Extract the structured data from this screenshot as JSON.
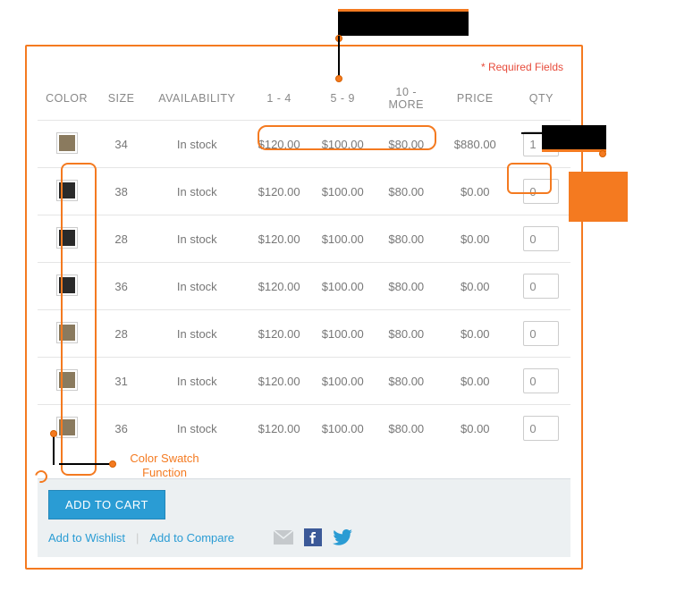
{
  "required_label": "* Required Fields",
  "headers": {
    "color": "COLOR",
    "size": "SIZE",
    "availability": "AVAILABILITY",
    "tier1": "1 - 4",
    "tier2": "5 - 9",
    "tier3": "10 - MORE",
    "price": "PRICE",
    "qty": "QTY"
  },
  "rows": [
    {
      "swatch": "#8a7a5e",
      "size": "34",
      "avail": "In stock",
      "t1": "$120.00",
      "t2": "$100.00",
      "t3": "$80.00",
      "price": "$880.00",
      "qty": "1"
    },
    {
      "swatch": "#2a2a2a",
      "size": "38",
      "avail": "In stock",
      "t1": "$120.00",
      "t2": "$100.00",
      "t3": "$80.00",
      "price": "$0.00",
      "qty": "0"
    },
    {
      "swatch": "#2a2a2a",
      "size": "28",
      "avail": "In stock",
      "t1": "$120.00",
      "t2": "$100.00",
      "t3": "$80.00",
      "price": "$0.00",
      "qty": "0"
    },
    {
      "swatch": "#2a2a2a",
      "size": "36",
      "avail": "In stock",
      "t1": "$120.00",
      "t2": "$100.00",
      "t3": "$80.00",
      "price": "$0.00",
      "qty": "0"
    },
    {
      "swatch": "#8a7a5e",
      "size": "28",
      "avail": "In stock",
      "t1": "$120.00",
      "t2": "$100.00",
      "t3": "$80.00",
      "price": "$0.00",
      "qty": "0"
    },
    {
      "swatch": "#8a7a5e",
      "size": "31",
      "avail": "In stock",
      "t1": "$120.00",
      "t2": "$100.00",
      "t3": "$80.00",
      "price": "$0.00",
      "qty": "0"
    },
    {
      "swatch": "#8a7a5e",
      "size": "36",
      "avail": "In stock",
      "t1": "$120.00",
      "t2": "$100.00",
      "t3": "$80.00",
      "price": "$0.00",
      "qty": "0"
    }
  ],
  "buttons": {
    "add_to_cart": "ADD TO CART",
    "wishlist": "Add to Wishlist",
    "compare": "Add to Compare"
  },
  "annotations": {
    "color_swatch": "Color Swatch Function"
  },
  "chart_data": {
    "type": "table",
    "title": "Product Variant Pricing Grid",
    "columns": [
      "COLOR",
      "SIZE",
      "AVAILABILITY",
      "1 - 4",
      "5 - 9",
      "10 - MORE",
      "PRICE",
      "QTY"
    ],
    "rows": [
      [
        "tan",
        34,
        "In stock",
        120.0,
        100.0,
        80.0,
        880.0,
        1
      ],
      [
        "black",
        38,
        "In stock",
        120.0,
        100.0,
        80.0,
        0.0,
        0
      ],
      [
        "black",
        28,
        "In stock",
        120.0,
        100.0,
        80.0,
        0.0,
        0
      ],
      [
        "black",
        36,
        "In stock",
        120.0,
        100.0,
        80.0,
        0.0,
        0
      ],
      [
        "tan",
        28,
        "In stock",
        120.0,
        100.0,
        80.0,
        0.0,
        0
      ],
      [
        "tan",
        31,
        "In stock",
        120.0,
        100.0,
        80.0,
        0.0,
        0
      ],
      [
        "tan",
        36,
        "In stock",
        120.0,
        100.0,
        80.0,
        0.0,
        0
      ]
    ]
  }
}
